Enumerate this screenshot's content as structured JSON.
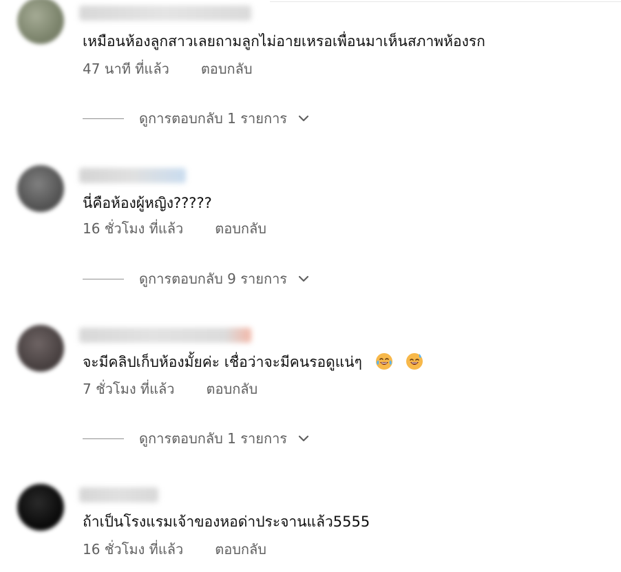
{
  "comments": [
    {
      "text": "เหมือนห้องลูกสาวเลยถามลูกไม่อายเหรอเพื่อนมาเห็นสภาพห้องรก",
      "time": "47 นาที ที่แล้ว",
      "reply_label": "ตอบกลับ",
      "replies_label": "ดูการตอบกลับ 1 รายการ",
      "avatar_color": "#8a9278"
    },
    {
      "text": "นี่คือห้องผู้หญิง?????",
      "time": "16 ชั่วโมง ที่แล้ว",
      "reply_label": "ตอบกลับ",
      "replies_label": "ดูการตอบกลับ 9 รายการ",
      "avatar_color": "#5a5a5a"
    },
    {
      "text": "จะมีคลิปเก็บห้องมั้ยค่ะ เชื่อว่าจะมีคนรอดูแน่ๆ",
      "emojis": [
        "laughing-tears-emoji",
        "grinning-sweat-emoji"
      ],
      "time": "7 ชั่วโมง ที่แล้ว",
      "reply_label": "ตอบกลับ",
      "replies_label": "ดูการตอบกลับ 1 รายการ",
      "avatar_color": "#4a4444"
    },
    {
      "text": "ถ้าเป็นโรงแรมเจ้าของหอด่าประจานแล้ว5555",
      "time": "16 ชั่วโมง ที่แล้ว",
      "reply_label": "ตอบกลับ",
      "avatar_color": "#111111"
    }
  ],
  "icons": {
    "expand": "chevron-down-icon"
  }
}
